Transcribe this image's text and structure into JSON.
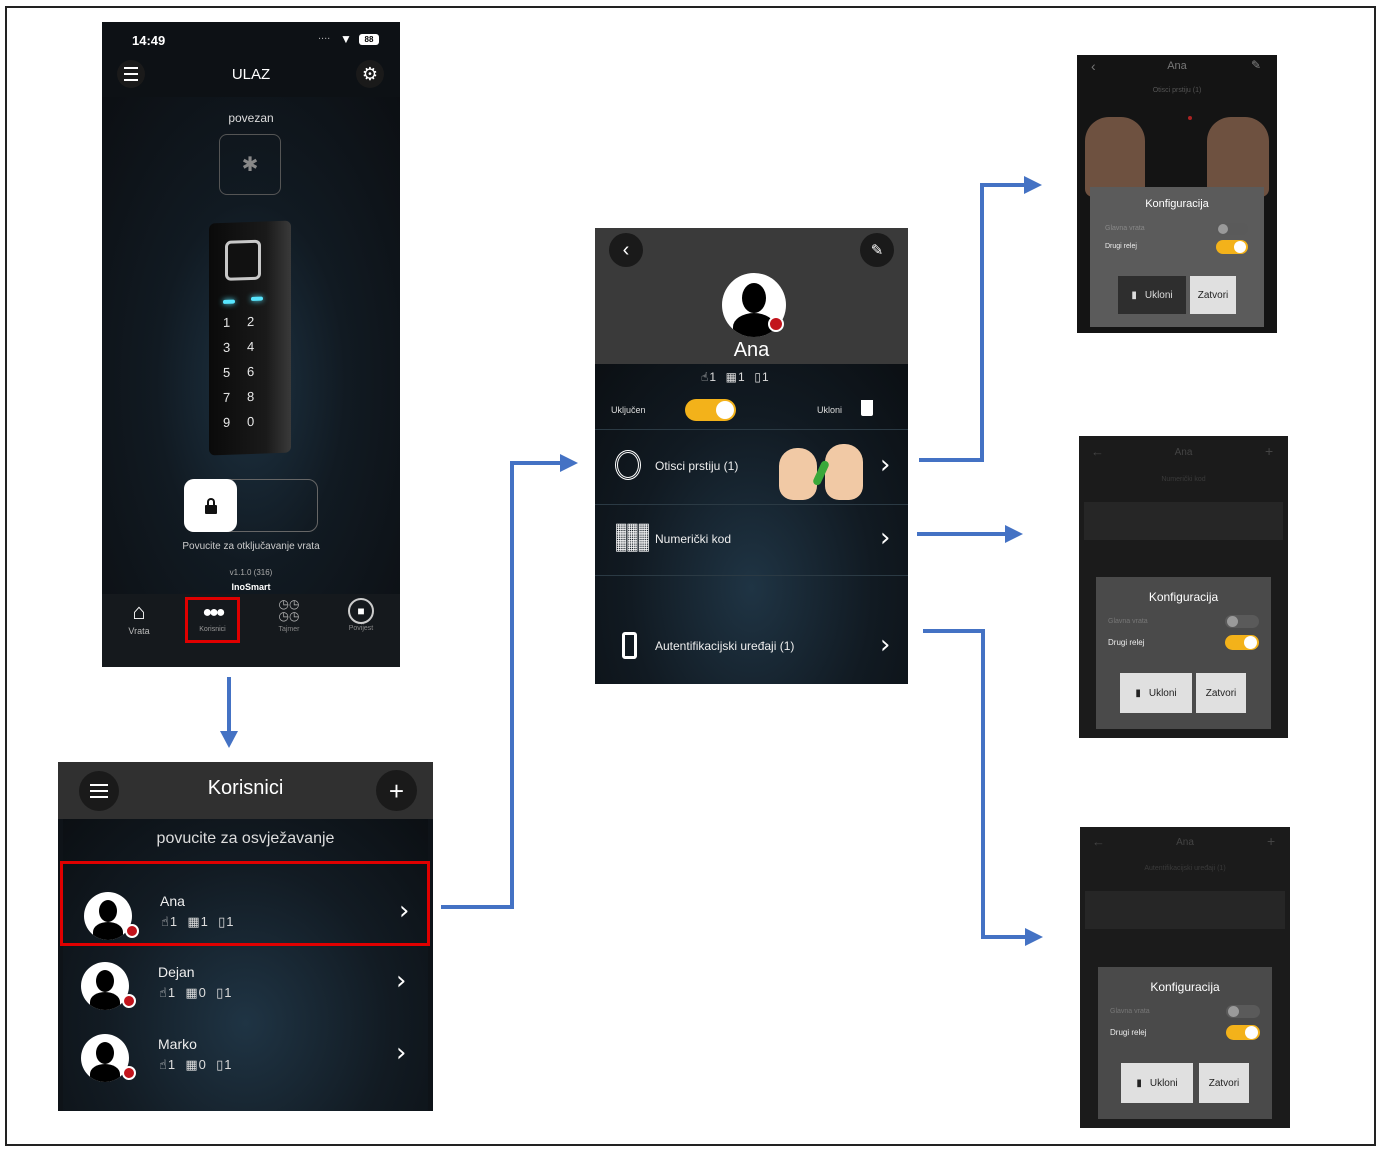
{
  "phone": {
    "status_time": "14:49",
    "status_signal": "....",
    "status_battery": "88",
    "title": "ULAZ",
    "connection_status": "povezan",
    "keypad_keys": [
      "1",
      "2",
      "3",
      "4",
      "5",
      "6",
      "7",
      "8",
      "9",
      "0"
    ],
    "slide_hint": "Povucite za otključavanje vrata",
    "version": "v1.1.0 (316)",
    "brand": "InoSmart",
    "nav": [
      {
        "label": "Vrata",
        "icon": "home-icon"
      },
      {
        "label": "Korisnici",
        "icon": "users-icon"
      },
      {
        "label": "Tajmer",
        "icon": "timer-icon"
      },
      {
        "label": "Povijest",
        "icon": "shield-lock-icon"
      }
    ]
  },
  "users_screen": {
    "title": "Korisnici",
    "refresh_hint": "povucite za osvježavanje",
    "users": [
      {
        "name": "Ana",
        "fingerprints": "1",
        "codes": "1",
        "devices": "1"
      },
      {
        "name": "Dejan",
        "fingerprints": "1",
        "codes": "0",
        "devices": "1"
      },
      {
        "name": "Marko",
        "fingerprints": "1",
        "codes": "0",
        "devices": "1"
      }
    ]
  },
  "user_detail": {
    "name": "Ana",
    "fingerprints": "1",
    "codes": "1",
    "devices": "1",
    "enabled_label": "Uključen",
    "remove_label": "Ukloni",
    "rows": [
      {
        "label": "Otisci prstiju (1)",
        "icon": "fingerprint-icon"
      },
      {
        "label": "Numerički kod",
        "icon": "keypad-icon"
      },
      {
        "label": "Autentifikacijski uređaji (1)",
        "icon": "phone-icon"
      }
    ]
  },
  "config_fingerprint": {
    "header_title": "Ana",
    "subtitle": "Otisci prstiju (1)",
    "modal_title": "Konfiguracija",
    "option_main": "Glavna vrata",
    "option_relay": "Drugi relej",
    "remove_button": "Ukloni",
    "close_button": "Zatvori"
  },
  "config_code": {
    "header_title": "Ana",
    "subtitle": "Numerički kod",
    "modal_title": "Konfiguracija",
    "option_main": "Glavna vrata",
    "option_relay": "Drugi relej",
    "remove_button": "Ukloni",
    "close_button": "Zatvori"
  },
  "config_device": {
    "header_title": "Ana",
    "subtitle": "Autentifikacijski uređaji (1)",
    "modal_title": "Konfiguracija",
    "option_main": "Glavna vrata",
    "option_relay": "Drugi relej",
    "remove_button": "Ukloni",
    "close_button": "Zatvori"
  },
  "colors": {
    "accent_toggle": "#f3b21a",
    "highlight_box": "#e00000",
    "arrow": "#4472c4",
    "badge": "#c2141c"
  }
}
